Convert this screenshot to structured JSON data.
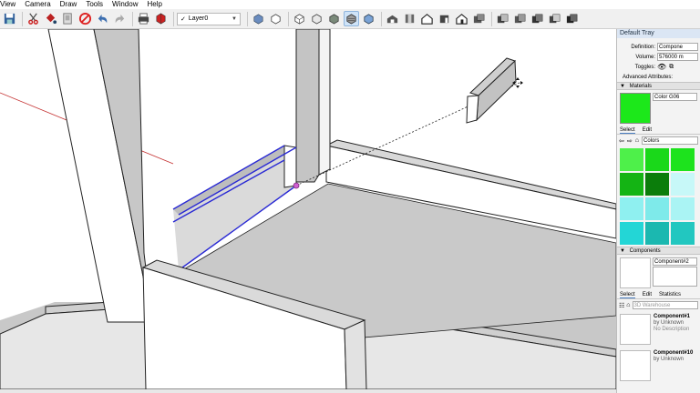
{
  "menu": {
    "items": [
      "View",
      "Camera",
      "Draw",
      "Tools",
      "Window",
      "Help"
    ]
  },
  "toolbar": {
    "layer_checked": "✓",
    "layer_value": "Layer0",
    "tool_icons": [
      "save-icon",
      "cut-icon",
      "paint-bucket-icon",
      "copy-icon",
      "erase-icon",
      "undo-icon",
      "redo-icon",
      "print-icon",
      "model-info-icon",
      "iso-view-icon",
      "top-view-icon",
      "front-view-icon",
      "right-view-icon",
      "back-view-icon",
      "left-view-icon",
      "xray-icon",
      "wireframe-icon",
      "hidden-line-icon",
      "shaded-icon",
      "shaded-textures-icon",
      "monochrome-icon",
      "warehouse-icon",
      "share-model-icon",
      "house-icon",
      "components-icon",
      "extension-warehouse-icon",
      "sandbox-icon",
      "stamp-icon",
      "drape-icon",
      "add-detail-icon",
      "flip-edge-icon"
    ]
  },
  "tray": {
    "title": "Default Tray",
    "entity_info": {
      "definition_label": "Definition:",
      "definition_value": "Compone",
      "volume_label": "Volume:",
      "volume_value": "576000 m",
      "toggles_label": "Toggles:",
      "advanced_label": "Advanced Attributes:"
    },
    "materials": {
      "header": "Materials",
      "current_name": "Color G06",
      "current_color": "#1ce81a",
      "tabs": [
        "Select",
        "Edit"
      ],
      "library": "Colors",
      "swatches": [
        "#4ef04a",
        "#1ad81a",
        "#1de31d",
        "#14b414",
        "#0b7d0b",
        "#c7f8f8",
        "#8ff0f0",
        "#7eeaea",
        "#aaf4f4",
        "#23d6d6",
        "#1bb8b0",
        "#22c7c0"
      ]
    },
    "components": {
      "header": "Components",
      "current_name": "Component#2",
      "tabs": [
        "Select",
        "Edit",
        "Statistics"
      ],
      "search_placeholder": "3D Warehouse",
      "items": [
        {
          "name": "Component#1",
          "by": "by Unknown",
          "desc": "No Description"
        },
        {
          "name": "Component#10",
          "by": "by Unknown",
          "desc": ""
        }
      ]
    }
  },
  "colors": {
    "highlight": "#2a2ad4",
    "axis_red": "#c43030",
    "inference_point": "#b040b0",
    "wood_face": "#ffffff",
    "wood_side": "#c4c4c4",
    "floor": "#c8c8c8"
  }
}
